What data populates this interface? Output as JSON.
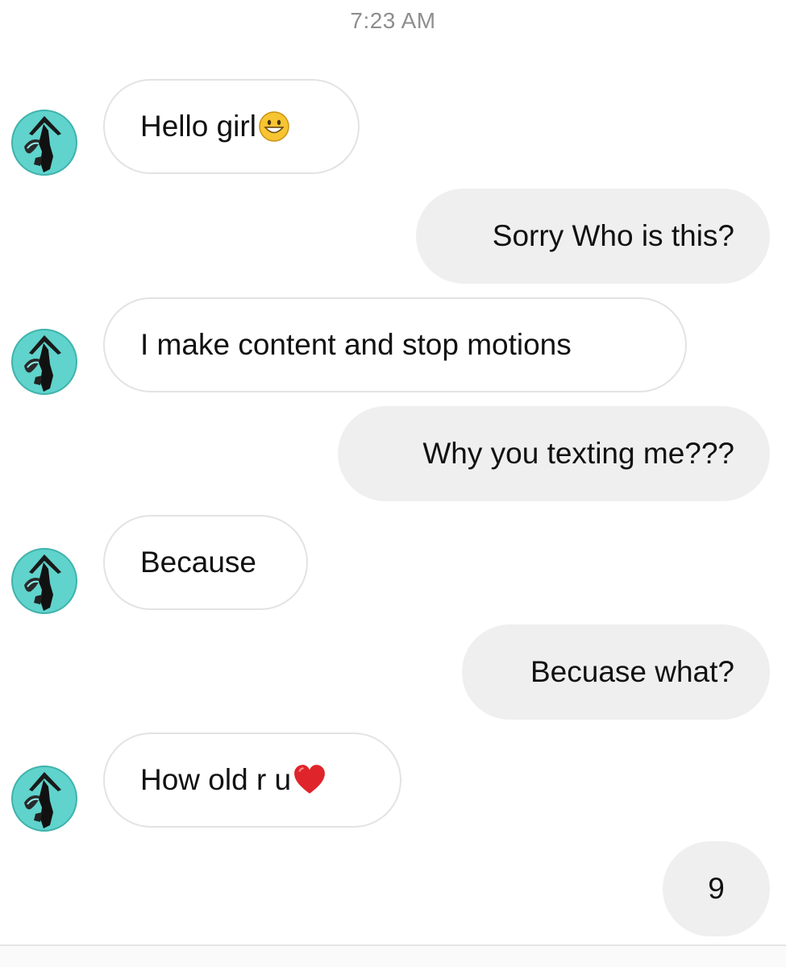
{
  "header": {
    "timestamp": "7:23 AM"
  },
  "messages": [
    {
      "sender": "them",
      "text": "Hello girl",
      "emoji": "grinning-face-emoji"
    },
    {
      "sender": "me",
      "text": "Sorry Who is this?"
    },
    {
      "sender": "them",
      "text": "I make content and stop motions"
    },
    {
      "sender": "me",
      "text": "Why you texting me???"
    },
    {
      "sender": "them",
      "text": "Because"
    },
    {
      "sender": "me",
      "text": "Becuase what?"
    },
    {
      "sender": "them",
      "text": "How old r u",
      "emoji": "red-heart-emoji"
    },
    {
      "sender": "me",
      "text": "9"
    }
  ],
  "colors": {
    "incoming_bubble_bg": "#ffffff",
    "incoming_bubble_border": "#e3e3e3",
    "outgoing_bubble_bg": "#efefef",
    "timestamp": "#8e8e8e",
    "avatar_accent": "#5fd3cc"
  }
}
